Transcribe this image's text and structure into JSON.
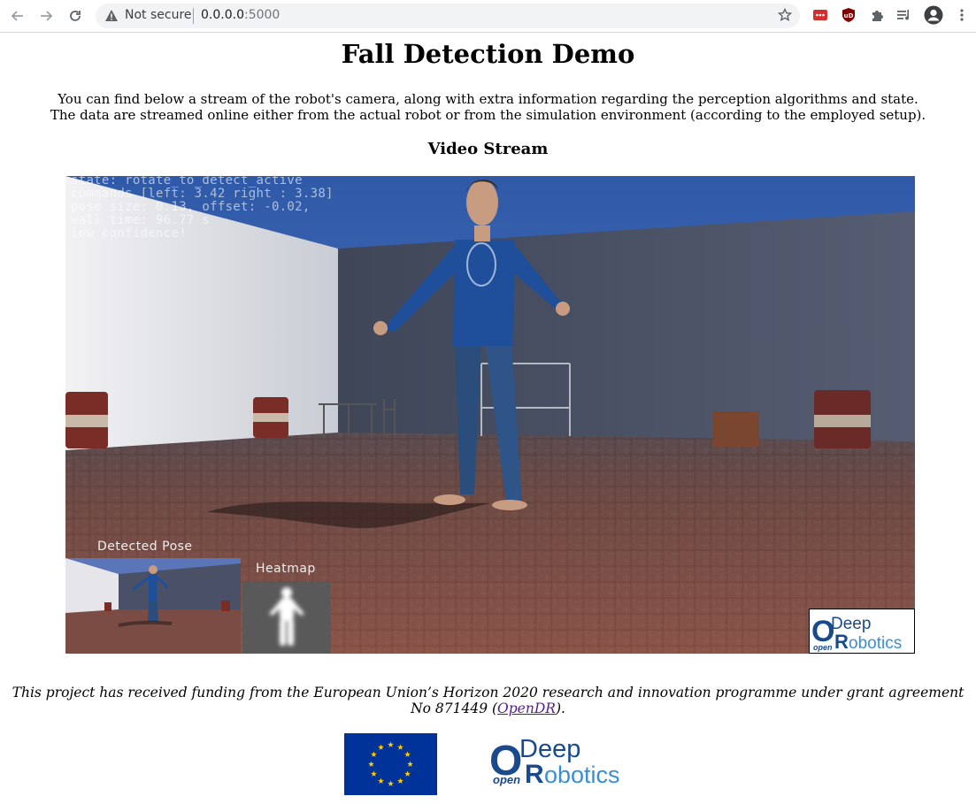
{
  "browser": {
    "security_text": "Not secure",
    "url_host": "0.0.0.0",
    "url_port": ":5000",
    "icons": [
      "back-icon",
      "forward-icon",
      "reload-icon",
      "warning-icon",
      "star-icon",
      "extension-icon",
      "ublock-icon",
      "puzzle-icon",
      "media-icon",
      "profile-icon",
      "menu-icon"
    ]
  },
  "page": {
    "title": "Fall Detection Demo",
    "intro_line1": "You can find below a stream of the robot's camera, along with extra information regarding the perception algorithms and state.",
    "intro_line2": "The data are streamed online either from the actual robot or from the simulation environment (according to the employed setup).",
    "section_title": "Video Stream"
  },
  "video": {
    "overlay": [
      "state: rotate_to_detect_active",
      "commands [left: 3.42 right : 3.38]",
      "pose size: 0.13, offset: -0.02,",
      "wall time: 96.77 s",
      "low confidence!"
    ],
    "pose_label": "Detected Pose",
    "heatmap_label": "Heatmap"
  },
  "logo": {
    "o": "O",
    "deep": "Deep",
    "open": "open",
    "r": "R",
    "obotics": "obotics"
  },
  "footer": {
    "funding_text": "This project has received funding from the European Union’s Horizon 2020 research and innovation programme under grant agreement No 871449 (",
    "link_text": "OpenDR",
    "funding_end": ")."
  },
  "colors": {
    "eu_blue": "#003399",
    "eu_star": "#ffcc00",
    "logo_dark": "#1a4a8c",
    "logo_light": "#3a8fd4",
    "link": "#551a8b"
  }
}
